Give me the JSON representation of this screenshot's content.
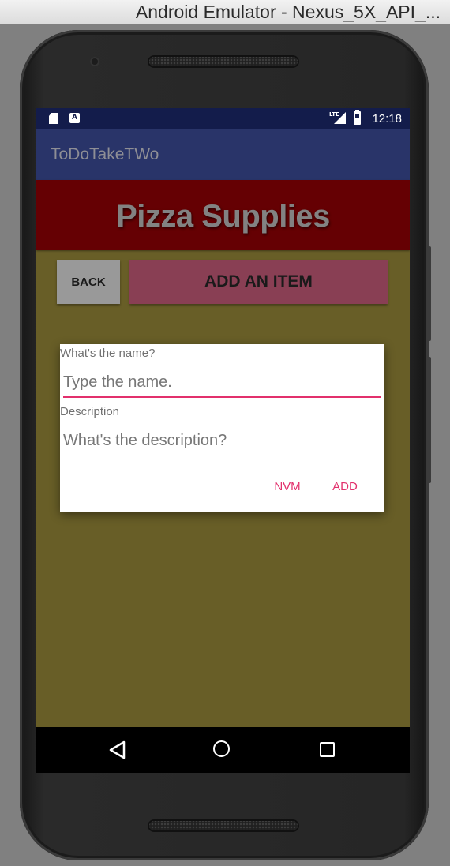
{
  "window": {
    "title": "Android Emulator - Nexus_5X_API_..."
  },
  "status_bar": {
    "time": "12:18",
    "network_label": "LTE"
  },
  "app_bar": {
    "title": "ToDoTakeTWo"
  },
  "header": {
    "title": "Pizza Supplies"
  },
  "buttons": {
    "back": "BACK",
    "add_item": "ADD AN ITEM"
  },
  "dialog": {
    "name_label": "What's the name?",
    "name_placeholder": "Type the name.",
    "description_label": "Description",
    "description_placeholder": "What's the description?",
    "cancel": "NVM",
    "confirm": "ADD"
  },
  "colors": {
    "status_bar": "#131c4b",
    "app_bar": "#293469",
    "header": "#650003",
    "background": "#685e27",
    "add_button": "#893f54",
    "back_button": "#999999",
    "accent": "#e2306c"
  },
  "icons": {
    "status": [
      "sd-card-icon",
      "a-notification-icon",
      "lte-signal-icon",
      "battery-icon"
    ],
    "navigation": [
      "back-triangle-icon",
      "home-circle-icon",
      "recents-square-icon"
    ]
  }
}
